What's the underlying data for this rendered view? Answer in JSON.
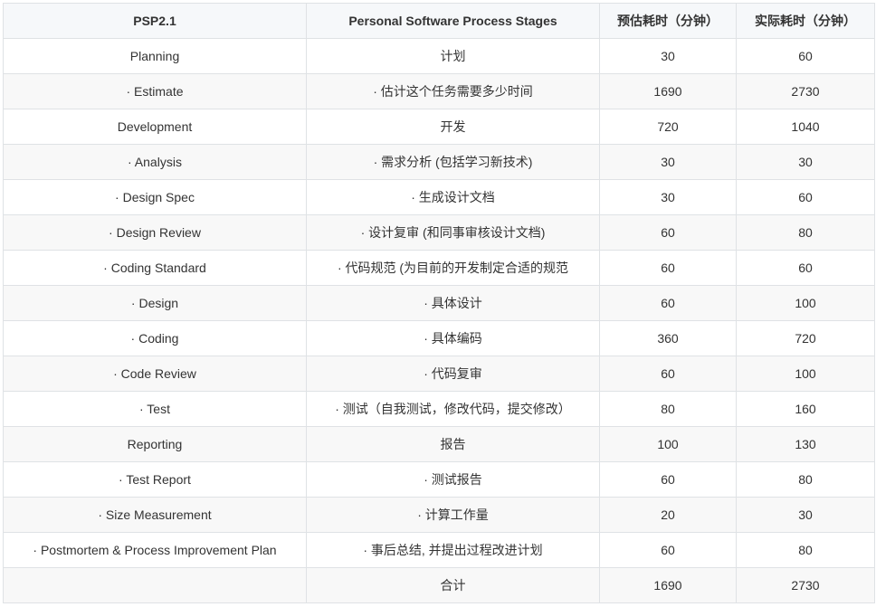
{
  "table": {
    "headers": [
      "PSP2.1",
      "Personal Software Process Stages",
      "预估耗时（分钟）",
      "实际耗时（分钟）"
    ],
    "rows": [
      [
        "Planning",
        "计划",
        "30",
        "60"
      ],
      [
        "· Estimate",
        "· 估计这个任务需要多少时间",
        "1690",
        "2730"
      ],
      [
        "Development",
        "开发",
        "720",
        "1040"
      ],
      [
        "· Analysis",
        "· 需求分析 (包括学习新技术)",
        "30",
        "30"
      ],
      [
        "· Design Spec",
        "· 生成设计文档",
        "30",
        "60"
      ],
      [
        "· Design Review",
        "· 设计复审 (和同事审核设计文档)",
        "60",
        "80"
      ],
      [
        "· Coding Standard",
        "· 代码规范 (为目前的开发制定合适的规范",
        "60",
        "60"
      ],
      [
        "· Design",
        "· 具体设计",
        "60",
        "100"
      ],
      [
        "· Coding",
        "· 具体编码",
        "360",
        "720"
      ],
      [
        "· Code Review",
        "· 代码复审",
        "60",
        "100"
      ],
      [
        "· Test",
        "· 测试（自我测试，修改代码，提交修改）",
        "80",
        "160"
      ],
      [
        "Reporting",
        "报告",
        "100",
        "130"
      ],
      [
        "· Test Report",
        "· 测试报告",
        "60",
        "80"
      ],
      [
        "· Size Measurement",
        "· 计算工作量",
        "20",
        "30"
      ],
      [
        "· Postmortem & Process Improvement Plan",
        "· 事后总结, 并提出过程改进计划",
        "60",
        "80"
      ],
      [
        "",
        "合计",
        "1690",
        "2730"
      ]
    ]
  }
}
